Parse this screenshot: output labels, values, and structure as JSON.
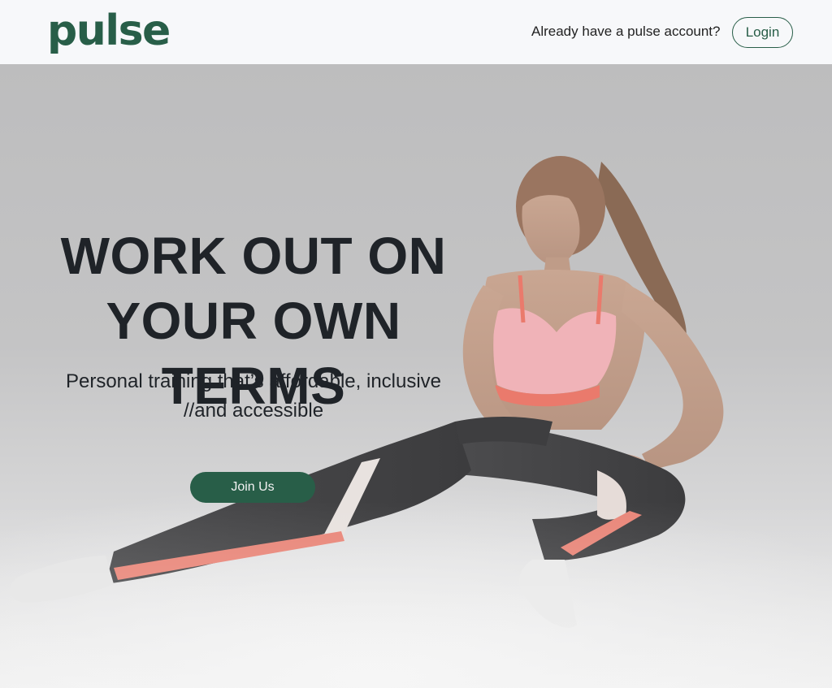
{
  "brand": {
    "logo_text": "pulse",
    "accent_color": "#285e48"
  },
  "header": {
    "account_prompt": "Already have a pulse account?",
    "login_label": "Login"
  },
  "hero": {
    "headline_line1": "WORK OUT ON",
    "headline_line2": "YOUR OWN TERMS",
    "subline_line1": "Personal training that’s affordable, inclusive",
    "subline_line2": "//and accessible",
    "join_label": "Join Us",
    "image_subject": "woman-stretching-lunge-photo"
  }
}
